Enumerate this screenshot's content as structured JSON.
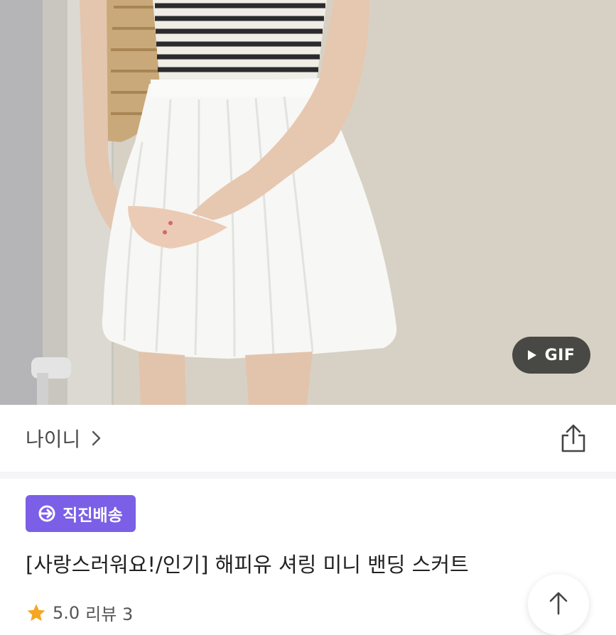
{
  "hero": {
    "gif_label": "GIF"
  },
  "shop": {
    "name": "나이니"
  },
  "product": {
    "badge_label": "직진배송",
    "badge_color": "#7b5fe6",
    "title": "[사랑스러워요!/인기] 해피유 셔링 미니 밴딩 스커트",
    "rating": "5.0",
    "review_label": "리뷰 3"
  },
  "icons": {
    "gif_play": "play-icon",
    "shop_arrow": "chevron-right-icon",
    "share": "share-icon",
    "delivery": "arrow-circle-icon",
    "rating": "star-icon",
    "scroll_top": "arrow-up-icon"
  }
}
